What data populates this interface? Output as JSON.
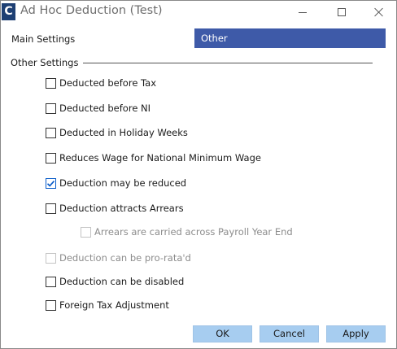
{
  "window": {
    "title": "Ad Hoc Deduction (Test)",
    "app_icon_letter": "C",
    "controls": [
      "minimize-icon",
      "maximize-icon",
      "close-icon"
    ]
  },
  "main_settings": {
    "label": "Main Settings",
    "selected": "Other"
  },
  "other_settings": {
    "heading": "Other Settings",
    "options": [
      {
        "label": "Deducted before Tax",
        "checked": false,
        "enabled": true
      },
      {
        "label": "Deducted before NI",
        "checked": false,
        "enabled": true
      },
      {
        "label": "Deducted in Holiday Weeks",
        "checked": false,
        "enabled": true
      },
      {
        "label": "Reduces Wage for National Minimum Wage",
        "checked": false,
        "enabled": true
      },
      {
        "label": "Deduction may be reduced",
        "checked": true,
        "enabled": true
      },
      {
        "label": "Deduction attracts Arrears",
        "checked": false,
        "enabled": true
      },
      {
        "label": "Arrears are carried across Payroll Year End",
        "checked": false,
        "enabled": false
      },
      {
        "label": "Deduction can be pro-rata'd",
        "checked": false,
        "enabled": false
      },
      {
        "label": "Deduction can be disabled",
        "checked": false,
        "enabled": true
      },
      {
        "label": "Foreign Tax Adjustment",
        "checked": false,
        "enabled": true
      }
    ]
  },
  "buttons": {
    "ok": "OK",
    "cancel": "Cancel",
    "apply": "Apply"
  },
  "colors": {
    "dropdown_bg": "#3e5aa8",
    "button_bg": "#a7cdf0",
    "check_accent": "#0a5cc9"
  }
}
